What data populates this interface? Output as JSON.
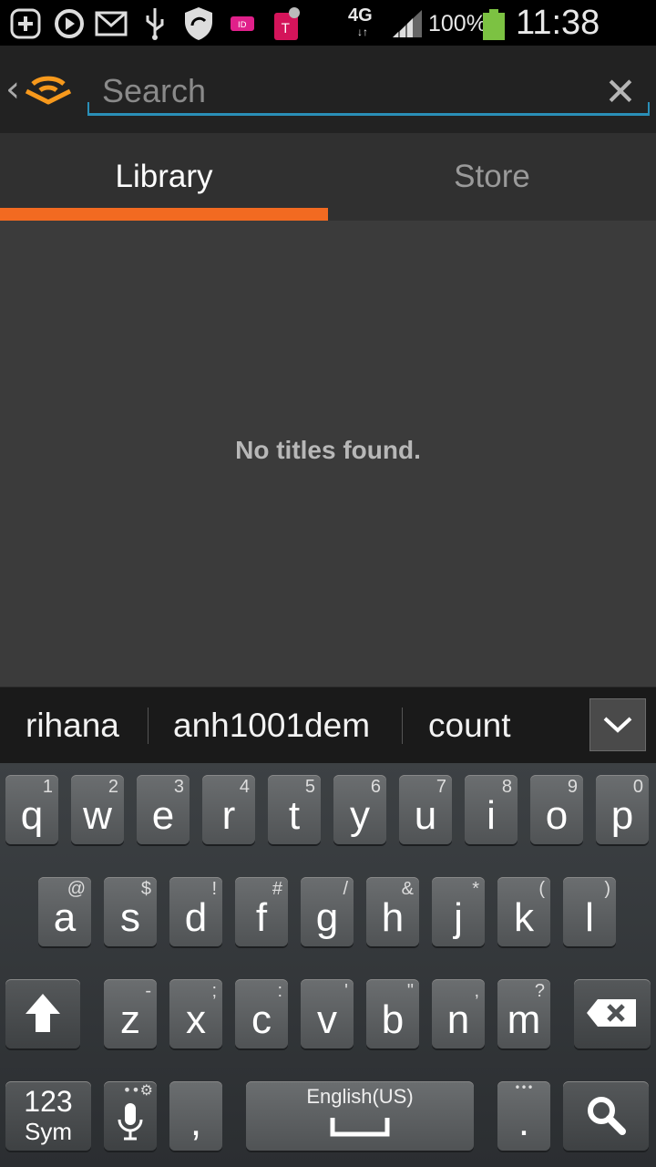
{
  "status_bar": {
    "network": "4G",
    "battery_percent": "100%",
    "time": "11:38 AM",
    "battery_color": "#7cc242",
    "icons": [
      "add-icon",
      "sync-icon",
      "mail-icon",
      "usb-icon",
      "shield-icon",
      "caller-id-icon",
      "tmobile-icon",
      "signal-icon",
      "battery-icon"
    ]
  },
  "action_bar": {
    "back_glyph": "‹",
    "logo": "audible-logo-icon",
    "search_placeholder": "Search",
    "search_value": "",
    "clear_glyph": "✕",
    "accent": "#2a8fb8"
  },
  "tabs": {
    "items": [
      {
        "label": "Library",
        "selected": true
      },
      {
        "label": "Store",
        "selected": false
      }
    ],
    "indicator_color": "#f26a21"
  },
  "content": {
    "empty_message": "No titles found."
  },
  "suggestions": {
    "items": [
      "rihana",
      "anh1001dem",
      "count"
    ]
  },
  "keyboard": {
    "row1": [
      {
        "main": "q",
        "hint": "1"
      },
      {
        "main": "w",
        "hint": "2"
      },
      {
        "main": "e",
        "hint": "3"
      },
      {
        "main": "r",
        "hint": "4"
      },
      {
        "main": "t",
        "hint": "5"
      },
      {
        "main": "y",
        "hint": "6"
      },
      {
        "main": "u",
        "hint": "7"
      },
      {
        "main": "i",
        "hint": "8"
      },
      {
        "main": "o",
        "hint": "9"
      },
      {
        "main": "p",
        "hint": "0"
      }
    ],
    "row2": [
      {
        "main": "a",
        "hint": "@"
      },
      {
        "main": "s",
        "hint": "$"
      },
      {
        "main": "d",
        "hint": "!"
      },
      {
        "main": "f",
        "hint": "#"
      },
      {
        "main": "g",
        "hint": "/"
      },
      {
        "main": "h",
        "hint": "&"
      },
      {
        "main": "j",
        "hint": "*"
      },
      {
        "main": "k",
        "hint": "("
      },
      {
        "main": "l",
        "hint": ")"
      }
    ],
    "row3": [
      {
        "main": "z",
        "hint": "-"
      },
      {
        "main": "x",
        "hint": ";"
      },
      {
        "main": "c",
        "hint": ":"
      },
      {
        "main": "v",
        "hint": "'"
      },
      {
        "main": "b",
        "hint": "\""
      },
      {
        "main": "n",
        "hint": ","
      },
      {
        "main": "m",
        "hint": "?"
      }
    ],
    "sym_top": "123",
    "sym_bottom": "Sym",
    "comma": ",",
    "space_label": "English(US)",
    "period": ".",
    "period_hint": "•••"
  }
}
